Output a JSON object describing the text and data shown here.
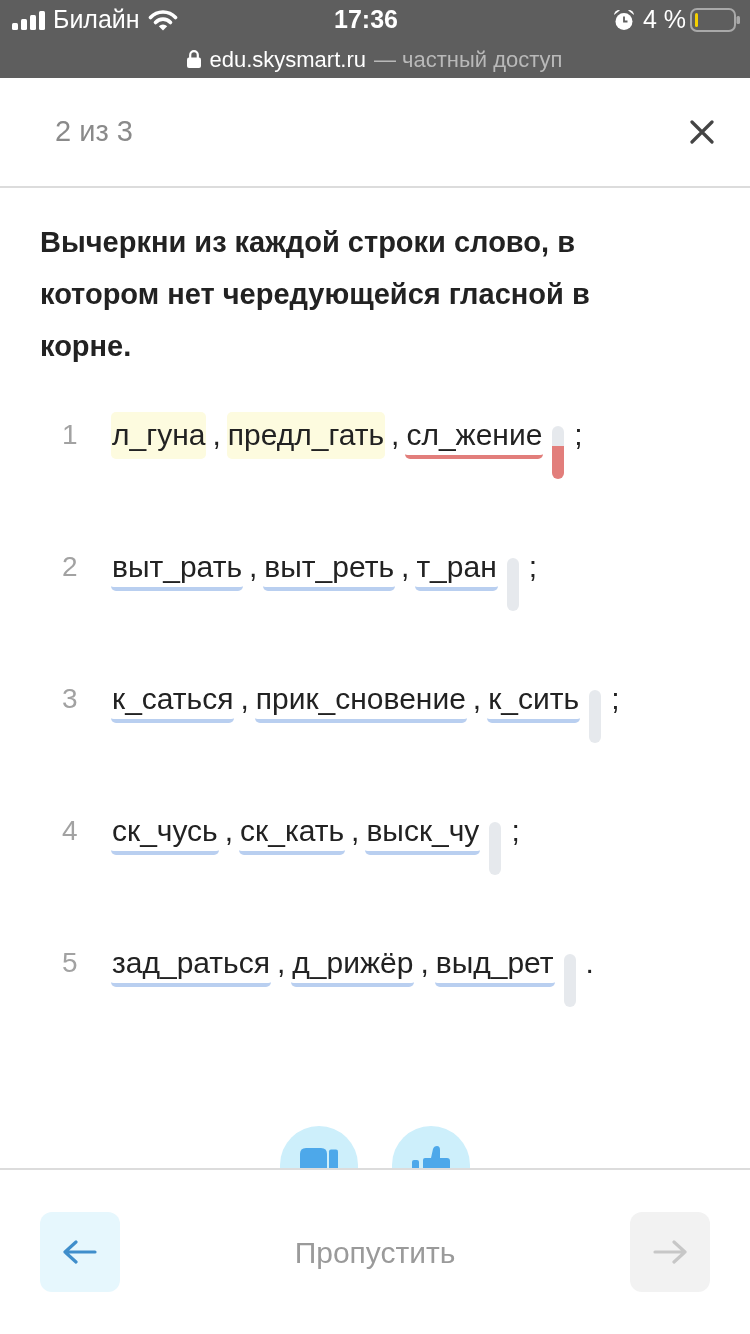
{
  "status_bar": {
    "carrier": "Билайн",
    "time": "17:36",
    "battery": "4 %"
  },
  "address_bar": {
    "domain": "edu.skysmart.ru",
    "note": "— частный доступ"
  },
  "header": {
    "progress": "2 из 3"
  },
  "question": "Вычеркни из каждой строки слово, в котором нет чередующейся гласной в корне.",
  "rows": [
    {
      "number": "1",
      "words": [
        {
          "text": "л_гуна",
          "highlighted": true,
          "error": false,
          "comma": ","
        },
        {
          "text": "предл_гать",
          "highlighted": true,
          "error": false,
          "comma": ","
        },
        {
          "text": "сл_жение",
          "highlighted": false,
          "error": true
        }
      ],
      "wrong": true,
      "end": ";"
    },
    {
      "number": "2",
      "words": [
        {
          "text": "выт_рать",
          "highlighted": false,
          "error": false,
          "comma": ","
        },
        {
          "text": "выт_реть",
          "highlighted": false,
          "error": false,
          "comma": ","
        },
        {
          "text": "т_ран",
          "highlighted": false,
          "error": false
        }
      ],
      "wrong": false,
      "end": ";"
    },
    {
      "number": "3",
      "words": [
        {
          "text": "к_саться",
          "highlighted": false,
          "error": false,
          "comma": ","
        },
        {
          "text": "прик_сновение",
          "highlighted": false,
          "error": false,
          "comma": ","
        },
        {
          "text": "к_сить",
          "highlighted": false,
          "error": false
        }
      ],
      "wrong": false,
      "end": ";"
    },
    {
      "number": "4",
      "words": [
        {
          "text": "ск_чусь",
          "highlighted": false,
          "error": false,
          "comma": ","
        },
        {
          "text": "ск_кать",
          "highlighted": false,
          "error": false,
          "comma": ","
        },
        {
          "text": "выск_чу",
          "highlighted": false,
          "error": false
        }
      ],
      "wrong": false,
      "end": ";"
    },
    {
      "number": "5",
      "words": [
        {
          "text": "зад_раться",
          "highlighted": false,
          "error": false,
          "comma": ","
        },
        {
          "text": "д_рижёр",
          "highlighted": false,
          "error": false,
          "comma": ","
        },
        {
          "text": "выд_рет",
          "highlighted": false,
          "error": false
        }
      ],
      "wrong": false,
      "end": "."
    }
  ],
  "footer": {
    "back": {
      "disabled": false
    },
    "skip": "Пропустить",
    "next": {
      "disabled": true
    }
  }
}
